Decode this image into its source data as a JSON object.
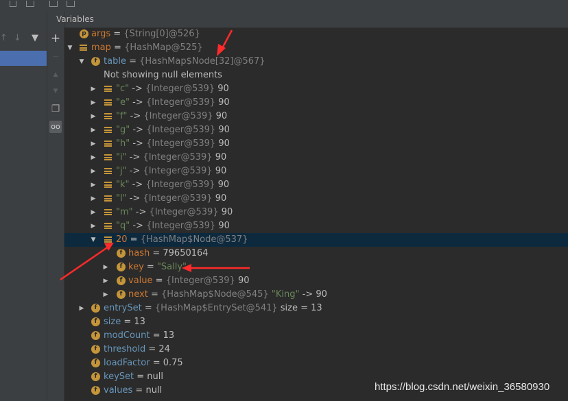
{
  "panel": {
    "title": "Variables"
  },
  "toolbar": {
    "up_icon": "arrow-up-icon",
    "down_icon": "arrow-down-icon",
    "filter_icon": "filter-icon",
    "add_icon": "plus-icon",
    "copy_icon": "copy-icon",
    "watch_icon": "glasses-icon"
  },
  "tree": {
    "args": {
      "name": "args",
      "eq": " = ",
      "ref": "{String[0]@526}"
    },
    "map": {
      "name": "map",
      "eq": " = ",
      "ref": "{HashMap@525}"
    },
    "table": {
      "name": "table",
      "eq": " = ",
      "ref": "{HashMap$Node[32]@567}"
    },
    "note": "Not showing null elements",
    "entries": [
      {
        "key": "\"c\"",
        "arrow": " -> ",
        "ref": "{Integer@539}",
        "val": " 90"
      },
      {
        "key": "\"e\"",
        "arrow": " -> ",
        "ref": "{Integer@539}",
        "val": " 90"
      },
      {
        "key": "\"f\"",
        "arrow": " -> ",
        "ref": "{Integer@539}",
        "val": " 90"
      },
      {
        "key": "\"g\"",
        "arrow": " -> ",
        "ref": "{Integer@539}",
        "val": " 90"
      },
      {
        "key": "\"h\"",
        "arrow": " -> ",
        "ref": "{Integer@539}",
        "val": " 90"
      },
      {
        "key": "\"i\"",
        "arrow": " -> ",
        "ref": "{Integer@539}",
        "val": " 90"
      },
      {
        "key": "\"j\"",
        "arrow": " -> ",
        "ref": "{Integer@539}",
        "val": " 90"
      },
      {
        "key": "\"k\"",
        "arrow": " -> ",
        "ref": "{Integer@539}",
        "val": " 90"
      },
      {
        "key": "\"l\"",
        "arrow": " -> ",
        "ref": "{Integer@539}",
        "val": " 90"
      },
      {
        "key": "\"m\"",
        "arrow": " -> ",
        "ref": "{Integer@539}",
        "val": " 90"
      },
      {
        "key": "\"q\"",
        "arrow": " -> ",
        "ref": "{Integer@539}",
        "val": " 90"
      }
    ],
    "node20": {
      "name": "20",
      "eq": " = ",
      "ref": "{HashMap$Node@537}"
    },
    "hash": {
      "name": "hash",
      "eq": " = ",
      "val": "79650164"
    },
    "key": {
      "name": "key",
      "eq": " = ",
      "val": "\"Sally\""
    },
    "value": {
      "name": "value",
      "eq": " = ",
      "ref": "{Integer@539}",
      "val": " 90"
    },
    "next": {
      "name": "next",
      "eq": " = ",
      "ref": "{HashMap$Node@545}",
      "key": " \"King\"",
      "arrow": " -> ",
      "val": "90"
    },
    "entrySet": {
      "name": "entrySet",
      "eq": " = ",
      "ref": "{HashMap$EntrySet@541}",
      "val": "  size = 13"
    },
    "size": {
      "name": "size",
      "eq": " = ",
      "val": "13"
    },
    "modCount": {
      "name": "modCount",
      "eq": " = ",
      "val": "13"
    },
    "threshold": {
      "name": "threshold",
      "eq": " = ",
      "val": "24"
    },
    "loadFactor": {
      "name": "loadFactor",
      "eq": " = ",
      "val": "0.75"
    },
    "keySet": {
      "name": "keySet",
      "eq": " = ",
      "val": "null"
    },
    "values": {
      "name": "values",
      "eq": " = ",
      "val": "null"
    }
  },
  "field_icon_letter": "f",
  "param_icon_letter": "p",
  "watermark": "https://blog.csdn.net/weixin_36580930",
  "colors": {
    "annotation_arrow": "#ff2a2a",
    "selection": "#0d293e",
    "field_icon": "#c5953a"
  }
}
